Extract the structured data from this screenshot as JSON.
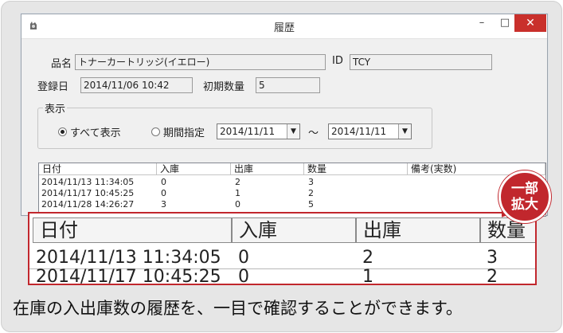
{
  "window": {
    "title": "履歴",
    "min_glyph": "–",
    "max_glyph": "□",
    "close_glyph": "✕"
  },
  "form": {
    "product_label": "品名",
    "product_value": "トナーカートリッジ(イエロー)",
    "id_label": "ID",
    "id_value": "TCY",
    "registered_label": "登録日",
    "registered_value": "2014/11/06 10:42",
    "initial_qty_label": "初期数量",
    "initial_qty_value": "5"
  },
  "display": {
    "group_label": "表示",
    "show_all_label": "すべて表示",
    "show_all_selected": true,
    "period_label": "期間指定",
    "period_selected": false,
    "date_from": "2014/11/11",
    "tilde": "〜",
    "date_to": "2014/11/11"
  },
  "history": {
    "columns": [
      "日付",
      "入庫",
      "出庫",
      "数量",
      "備考(実数)"
    ],
    "rows": [
      [
        "2014/11/13 11:34:05",
        "0",
        "2",
        "3",
        ""
      ],
      [
        "2014/11/17 10:45:25",
        "0",
        "1",
        "2",
        ""
      ],
      [
        "2014/11/28 14:26:27",
        "3",
        "0",
        "5",
        ""
      ]
    ]
  },
  "zoom": {
    "badge_line1": "一部",
    "badge_line2": "拡大",
    "columns": [
      "日付",
      "入庫",
      "出庫",
      "数量"
    ],
    "rows": [
      [
        "2014/11/13 11:34:05",
        "0",
        "2",
        "3"
      ],
      [
        "2014/11/17 10:45:25",
        "0",
        "1",
        "2"
      ]
    ]
  },
  "caption": "在庫の入出庫数の履歴を、一目で確認することができます。",
  "colors": {
    "accent_red": "#c1272d",
    "close_button": "#c9302c"
  }
}
